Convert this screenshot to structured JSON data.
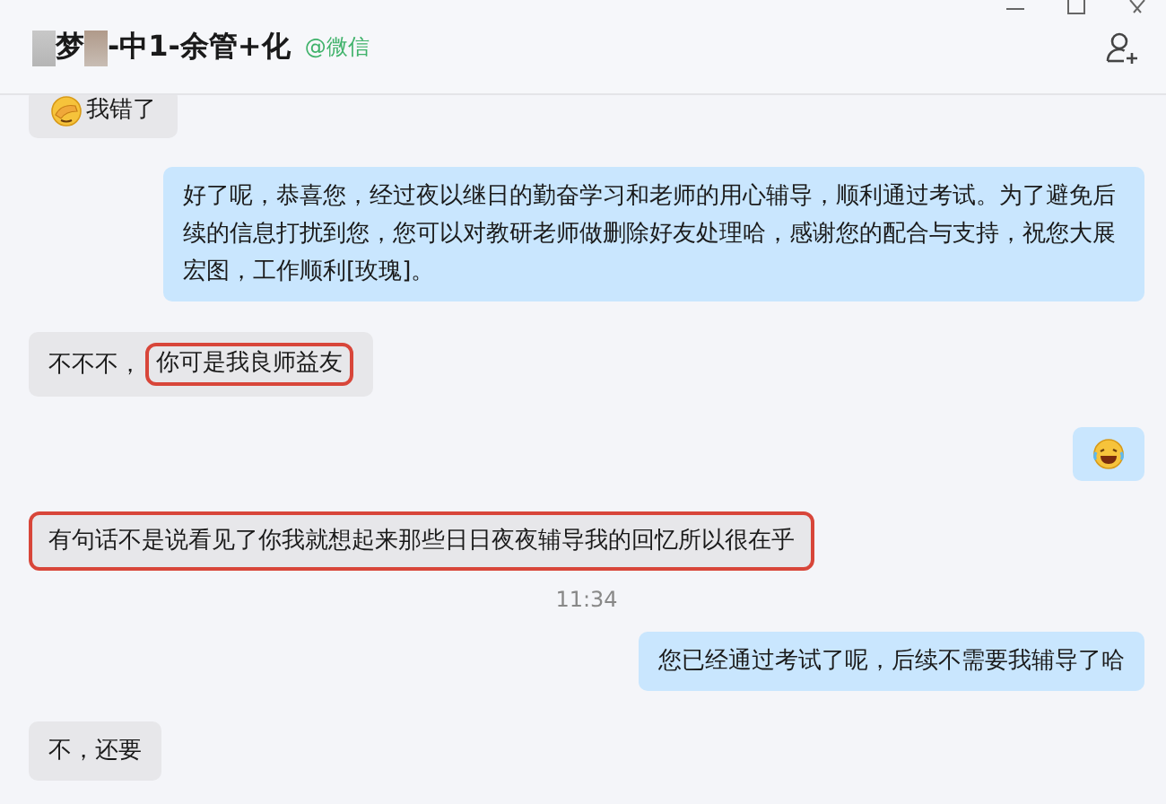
{
  "header": {
    "title_segments": [
      "梦",
      "-中1-余管+化"
    ],
    "source": "@微信"
  },
  "messages": [
    {
      "kind": "text",
      "outgoing": false,
      "leading_emoji": true,
      "highlighted": false,
      "parts": [
        {
          "text": "我错了",
          "highlighted": false
        }
      ]
    },
    {
      "kind": "text",
      "outgoing": true,
      "leading_emoji": false,
      "highlighted": false,
      "parts": [
        {
          "text": "好了呢，恭喜您，经过夜以继日的勤奋学习和老师的用心辅导，顺利通过考试。为了避免后续的信息打扰到您，您可以对教研老师做删除好友处理哈，感谢您的配合与支持，祝您大展宏图，工作顺利[玫瑰]。",
          "highlighted": false
        }
      ]
    },
    {
      "kind": "text",
      "outgoing": false,
      "leading_emoji": false,
      "highlighted": false,
      "parts": [
        {
          "text": "不不不，",
          "highlighted": false
        },
        {
          "text": "你可是我良师益友",
          "highlighted": true
        }
      ]
    },
    {
      "kind": "emoji",
      "outgoing": true
    },
    {
      "kind": "text",
      "outgoing": false,
      "leading_emoji": false,
      "highlighted": true,
      "parts": [
        {
          "text": "有句话不是说看见了你我就想起来那些日日夜夜辅导我的回忆所以很在乎",
          "highlighted": false
        }
      ]
    },
    {
      "kind": "time",
      "text": "11:34"
    },
    {
      "kind": "text",
      "outgoing": true,
      "leading_emoji": false,
      "highlighted": false,
      "parts": [
        {
          "text": "您已经通过考试了呢，后续不需要我辅导了哈",
          "highlighted": false
        }
      ]
    },
    {
      "kind": "text",
      "outgoing": false,
      "leading_emoji": false,
      "highlighted": false,
      "parts": [
        {
          "text": "不，还要",
          "highlighted": false
        }
      ]
    }
  ]
}
